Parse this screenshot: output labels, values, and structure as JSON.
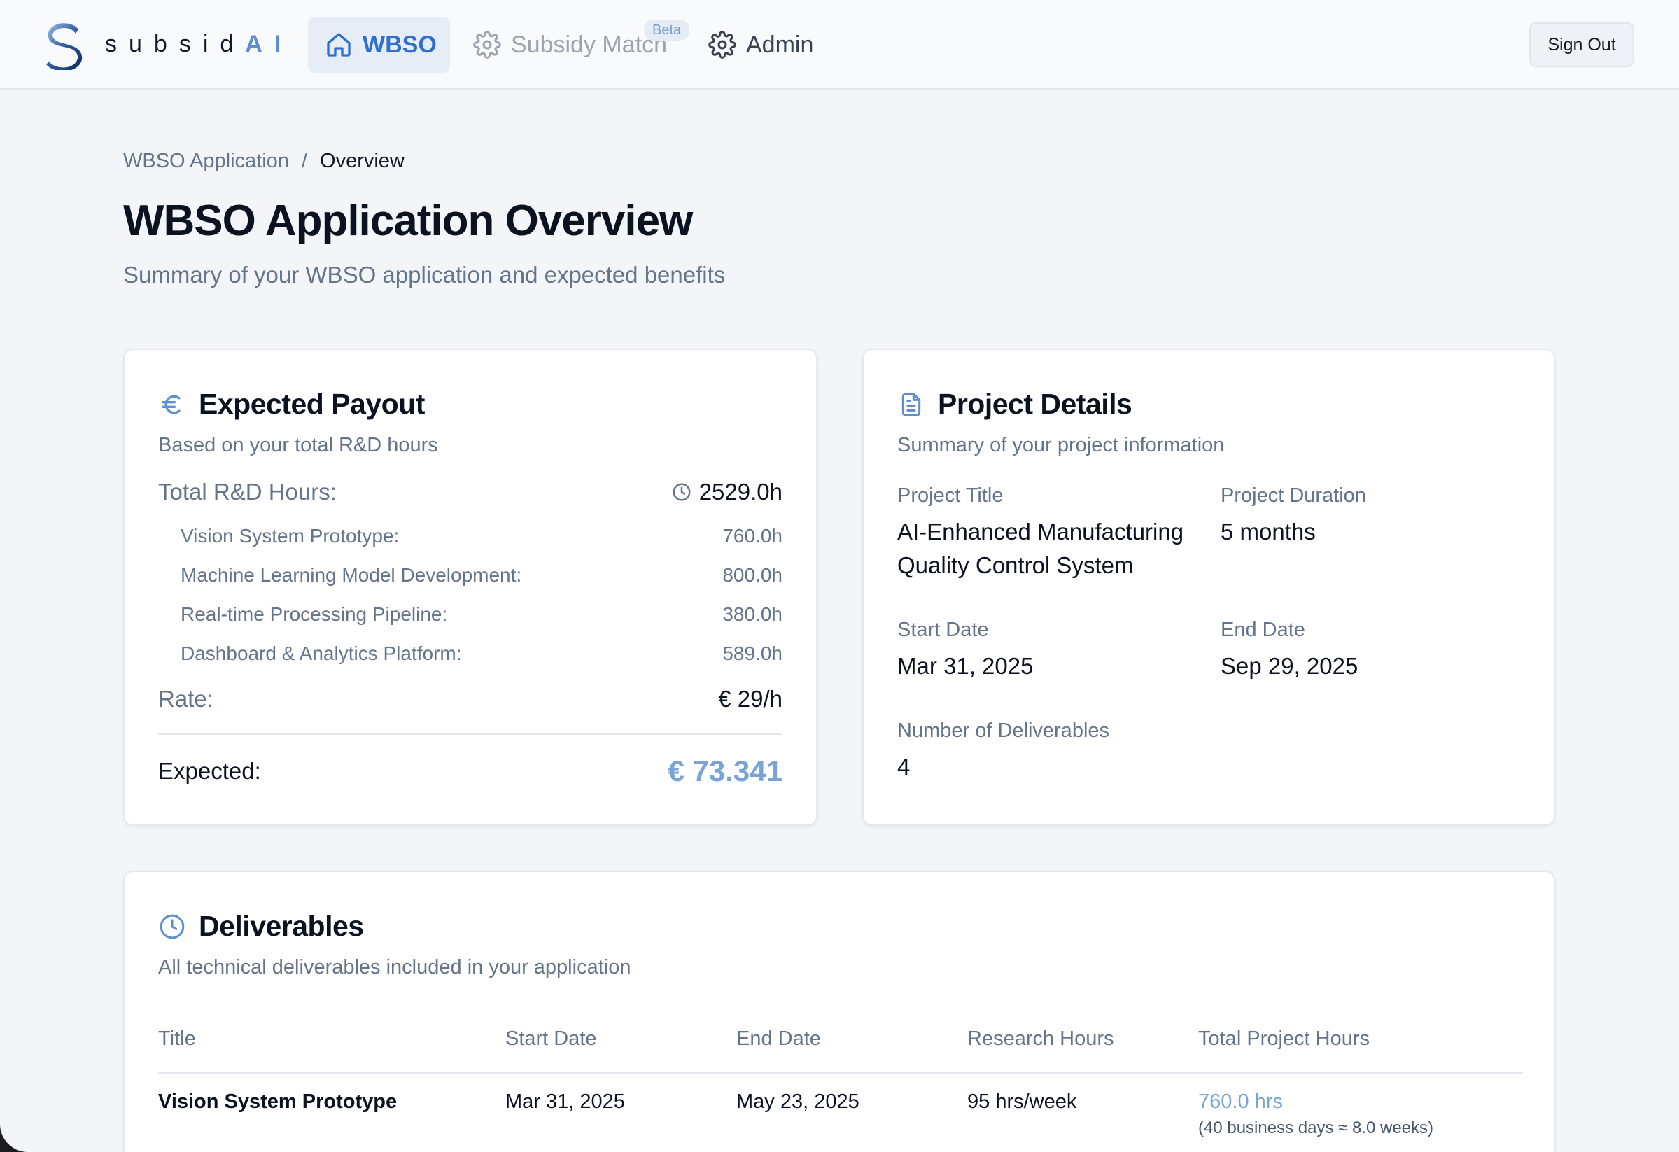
{
  "brand": {
    "name": "subsid",
    "suffix": "AI"
  },
  "nav": {
    "wbso": "WBSO",
    "subsidy_match": "Subsidy Match",
    "beta_badge": "Beta",
    "admin": "Admin",
    "sign_out": "Sign Out"
  },
  "breadcrumb": {
    "parent": "WBSO Application",
    "separator": "/",
    "current": "Overview"
  },
  "page": {
    "title": "WBSO Application Overview",
    "subtitle": "Summary of your WBSO application and expected benefits"
  },
  "payout": {
    "title": "Expected Payout",
    "subtitle": "Based on your total R&D hours",
    "total_label": "Total R&D Hours:",
    "total_value": "2529.0h",
    "items": [
      {
        "label": "Vision System Prototype:",
        "value": "760.0h"
      },
      {
        "label": "Machine Learning Model Development:",
        "value": "800.0h"
      },
      {
        "label": "Real-time Processing Pipeline:",
        "value": "380.0h"
      },
      {
        "label": "Dashboard & Analytics Platform:",
        "value": "589.0h"
      }
    ],
    "rate_label": "Rate:",
    "rate_value": "€ 29/h",
    "expected_label": "Expected:",
    "expected_value": "€ 73.341"
  },
  "project": {
    "title": "Project Details",
    "subtitle": "Summary of your project information",
    "title_label": "Project Title",
    "title_value": "AI-Enhanced Manufacturing Quality Control System",
    "duration_label": "Project Duration",
    "duration_value": "5 months",
    "start_label": "Start Date",
    "start_value": "Mar 31, 2025",
    "end_label": "End Date",
    "end_value": "Sep 29, 2025",
    "deliverables_label": "Number of Deliverables",
    "deliverables_value": "4"
  },
  "deliverables": {
    "title": "Deliverables",
    "subtitle": "All technical deliverables included in your application",
    "columns": [
      "Title",
      "Start Date",
      "End Date",
      "Research Hours",
      "Total Project Hours"
    ],
    "rows": [
      {
        "title": "Vision System Prototype",
        "start": "Mar 31, 2025",
        "end": "May 23, 2025",
        "research": "95 hrs/week",
        "total": "760.0 hrs",
        "note": "(40 business days ≈ 8.0 weeks)"
      }
    ]
  },
  "icons": {
    "logo": "subsidai-logo",
    "wbso": "home-icon",
    "subsidy": "gear-icon",
    "admin": "gear-icon",
    "payout": "euro-icon",
    "project": "document-icon",
    "deliverables": "clock-icon",
    "total_hours": "clock-icon"
  },
  "colors": {
    "accent": "#2f6fd0",
    "highlight": "#7aa3d6",
    "muted": "#64748b"
  }
}
